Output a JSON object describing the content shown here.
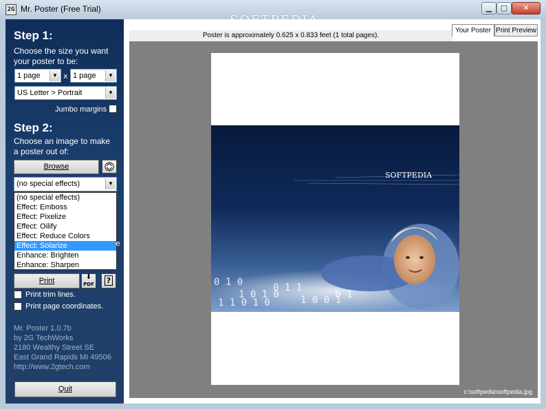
{
  "window": {
    "title": "Mr. Poster (Free Trial)",
    "watermark": "SOFTPEDIA",
    "min": "▁",
    "max": "□",
    "close": "✕",
    "app_icon_text": "2G"
  },
  "step1": {
    "title": "Step 1:",
    "desc": "Choose the size you want your poster to be:",
    "width_select": "1 page",
    "height_select": "1 page",
    "times": "x",
    "paper_select": "US Letter > Portrait",
    "jumbo_label": "Jumbo margins"
  },
  "step2": {
    "title": "Step 2:",
    "desc": "Choose an image to make a poster out of:",
    "browse_label": "Browse",
    "effects_select": "(no special effects)",
    "effects_options": [
      "(no special effects)",
      "Effect: Emboss",
      "Effect: Pixelize",
      "Effect: Oilify",
      "Effect: Reduce Colors",
      "Effect: Solarize",
      "Enhance: Brighten",
      "Enhance: Sharpen"
    ],
    "selected_option": "Effect: Solarize",
    "cut_char": "e"
  },
  "print": {
    "label": "Print",
    "pdf_icon_text": "PDF",
    "help_icon_text": "?",
    "trim_lines": "Print trim lines.",
    "page_coords": "Print page coordinates."
  },
  "about": {
    "line1": "Mr. Poster 1.0.7b",
    "line2": "by 2G TechWorks",
    "line3": "2180 Wealthy Street SE",
    "line4": "East Grand Rapids  MI  49506",
    "line5": "http://www.2gtech.com"
  },
  "quit_label": "Quit",
  "preview": {
    "info": "Poster is approximately 0.625 x 0.833 feet (1 total pages).",
    "tab_your": "Your Poster",
    "tab_print": "Print Preview",
    "image_watermark": "SOFTPEDIA",
    "filepath": "c:\\softpedia\\softpedia.jpg"
  }
}
